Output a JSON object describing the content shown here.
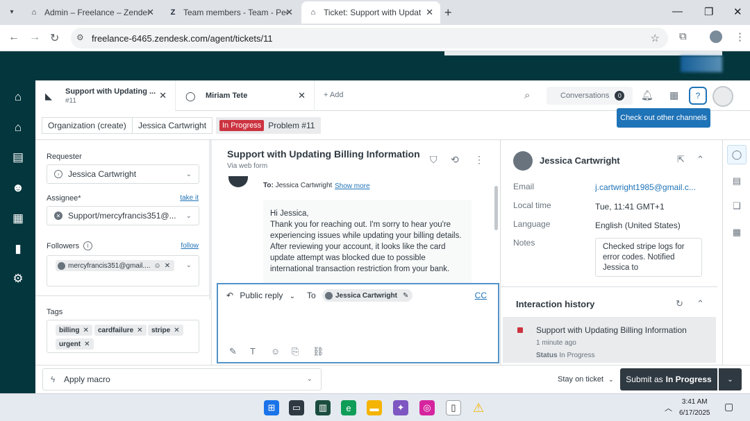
{
  "browser": {
    "tabs": [
      {
        "title": "Admin – Freelance – Zendesk",
        "favicon": "zendesk-icon",
        "active": false
      },
      {
        "title": "Team members - Team - People",
        "favicon": "zendesk-z-icon",
        "active": false
      },
      {
        "title": "Ticket: Support with Updating Billing Information",
        "favicon": "zendesk-icon",
        "active": true
      }
    ],
    "url": "freelance-6465.zendesk.com/agent/tickets/11"
  },
  "top_tabs": [
    {
      "title": "Support with Updating ...",
      "sub": "#11"
    },
    {
      "title": "Miriam Tete",
      "sub": ""
    }
  ],
  "add_label": "+ Add",
  "conversations": {
    "label": "Conversations",
    "count": "0"
  },
  "tooltip": "Check out other channels",
  "breadcrumbs": {
    "org": "Organization (create)",
    "requester": "Jessica Cartwright",
    "status_badge": "In Progress",
    "ticket": "Problem #11"
  },
  "properties": {
    "requester_label": "Requester",
    "requester_value": "Jessica Cartwright",
    "assignee_label": "Assignee*",
    "take_it": "take it",
    "assignee_value": "Support/mercyfrancis351@...",
    "followers_label": "Followers",
    "follow": "follow",
    "follower_chip": "mercyfrancis351@gmail....",
    "tags_label": "Tags",
    "tags": [
      "billing",
      "cardfailure",
      "stripe",
      "urgent"
    ]
  },
  "ticket": {
    "title": "Support with Updating Billing Information",
    "channel": "Via web form",
    "to_label": "To:",
    "to_value": "Jessica Cartwright",
    "show_more": "Show more",
    "message": [
      "Hi Jessica,",
      "Thank you for reaching out. I'm sorry to hear you're experiencing issues while updating your billing details.",
      "After reviewing your account, it looks like the card update attempt was blocked due to possible international transaction restriction from your bank."
    ]
  },
  "composer": {
    "reply_type": "Public reply",
    "to_label": "To",
    "to_chip": "Jessica Cartwright",
    "cc": "CC"
  },
  "customer": {
    "name": "Jessica Cartwright",
    "fields": [
      {
        "label": "Email",
        "value": "j.cartwright1985@gmail.c..."
      },
      {
        "label": "Local time",
        "value": "Tue, 11:41 GMT+1"
      },
      {
        "label": "Language",
        "value": "English (United States)"
      },
      {
        "label": "Notes",
        "value": ""
      }
    ],
    "notes": "Checked stripe logs for error codes. Notified Jessica to"
  },
  "interaction_history": {
    "title": "Interaction history",
    "items": [
      {
        "title": "Support with Updating Billing Information",
        "time": "1 minute ago",
        "status_label": "Status",
        "status_value": "In Progress"
      }
    ]
  },
  "footer": {
    "macro": "Apply macro",
    "stay": "Stay on ticket",
    "submit_prefix": "Submit as",
    "submit_status": "In Progress"
  },
  "system": {
    "time": "3:41 AM",
    "date": "6/17/2025"
  },
  "colors": {
    "zendesk_nav": "#03363d",
    "status_red": "#cc3340",
    "link_blue": "#1f73b7",
    "submit_dark": "#2f3941"
  }
}
